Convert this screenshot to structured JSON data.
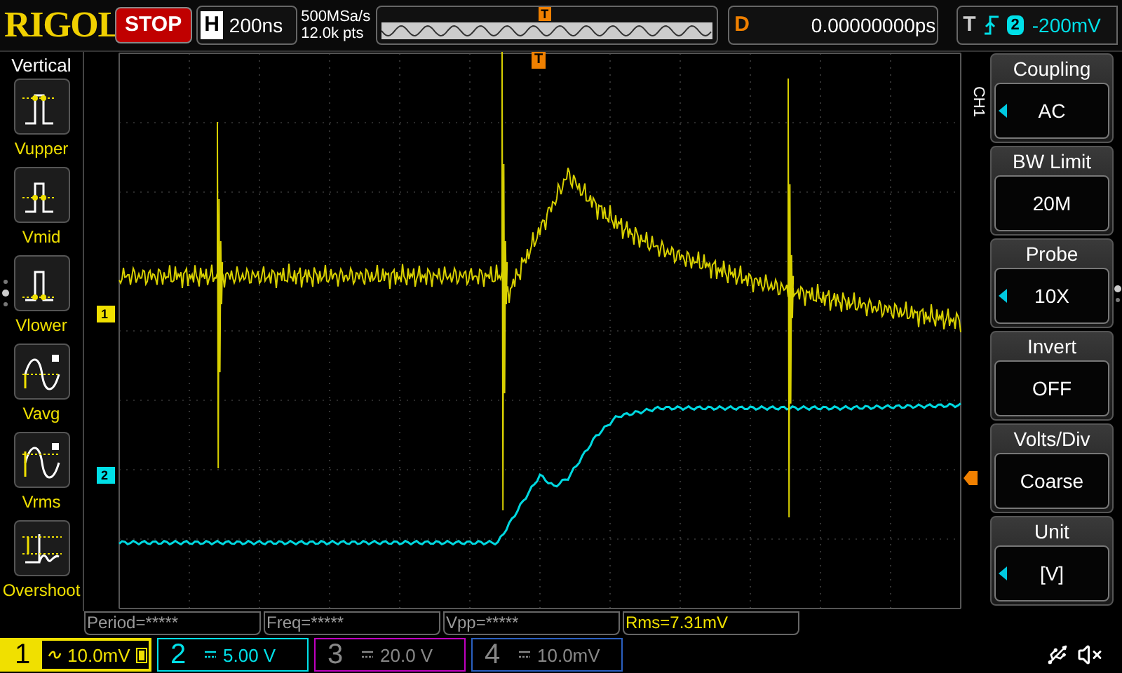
{
  "brand": "RIGOL",
  "run_state": {
    "label": "STOP",
    "kind": "stop"
  },
  "horizontal": {
    "label": "H",
    "timebase": "200ns",
    "sample_rate": "500MSa/s",
    "memory_depth": "12.0k pts"
  },
  "overview": {
    "trigger_marker": "T"
  },
  "delay": {
    "label": "D",
    "value": "0.00000000ps"
  },
  "trigger": {
    "label": "T",
    "kind": "rising_edge",
    "source": "2",
    "level": "-200mV"
  },
  "left_menu": {
    "title": "Vertical",
    "items": [
      {
        "label": "Vupper",
        "kind": "vupper"
      },
      {
        "label": "Vmid",
        "kind": "vmid"
      },
      {
        "label": "Vlower",
        "kind": "vlower"
      },
      {
        "label": "Vavg",
        "kind": "vavg"
      },
      {
        "label": "Vrms",
        "kind": "vrms"
      },
      {
        "label": "Overshoot",
        "kind": "overshoot"
      }
    ]
  },
  "display": {
    "trigger_marker": "T",
    "channel_markers": [
      {
        "label": "1",
        "color": "#f0e000"
      },
      {
        "label": "2",
        "color": "#00e0e8"
      }
    ]
  },
  "menu_channel": "CH1",
  "right_menu": [
    {
      "title": "Coupling",
      "value": "AC",
      "adjustable": true
    },
    {
      "title": "BW Limit",
      "value": "20M",
      "adjustable": false
    },
    {
      "title": "Probe",
      "value": "10X",
      "adjustable": true
    },
    {
      "title": "Invert",
      "value": "OFF",
      "adjustable": false
    },
    {
      "title": "Volts/Div",
      "value": "Coarse",
      "adjustable": false
    },
    {
      "title": "Unit",
      "value": "[V]",
      "adjustable": true
    }
  ],
  "measurements": [
    {
      "text": "Period=*****",
      "active": false
    },
    {
      "text": "Freq=*****",
      "active": false
    },
    {
      "text": "Vpp=*****",
      "active": false
    },
    {
      "text": "Rms=7.31mV",
      "active": true
    }
  ],
  "channels": [
    {
      "number": "1",
      "kind": "ac",
      "scale": "10.0mV",
      "on": true,
      "selected": true,
      "bw_limit": true,
      "color": "#f0e000"
    },
    {
      "number": "2",
      "kind": "dc",
      "scale": "5.00 V",
      "on": true,
      "selected": false,
      "bw_limit": false,
      "color": "#00e0e8"
    },
    {
      "number": "3",
      "kind": "dc",
      "scale": "20.0 V",
      "on": false,
      "selected": false,
      "bw_limit": false,
      "color": "#c000c0"
    },
    {
      "number": "4",
      "kind": "dc",
      "scale": "10.0mV",
      "on": false,
      "selected": false,
      "bw_limit": false,
      "color": "#2a5fc0"
    }
  ]
}
